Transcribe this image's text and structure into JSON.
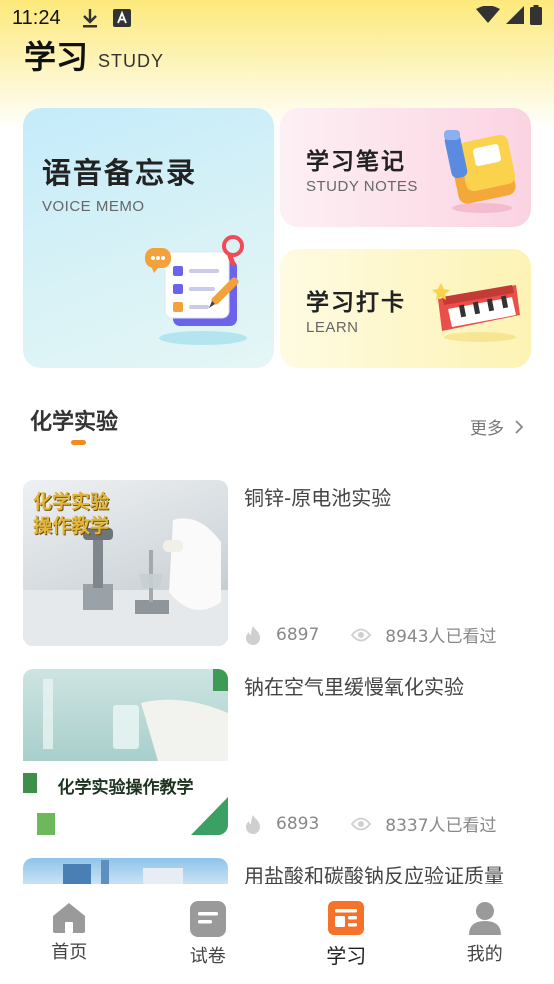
{
  "status_bar": {
    "time": "11:24"
  },
  "header": {
    "title": "学习",
    "subtitle": "STUDY"
  },
  "cards": {
    "voice": {
      "title": "语音备忘录",
      "subtitle": "VOICE MEMO"
    },
    "notes": {
      "title": "学习笔记",
      "subtitle": "STUDY NOTES"
    },
    "learn": {
      "title": "学习打卡",
      "subtitle": "LEARN"
    }
  },
  "section": {
    "title": "化学实验",
    "more_label": "更多",
    "accent_color": "#f58a1f"
  },
  "videos": [
    {
      "title": "铜锌-原电池实验",
      "heat": "6897",
      "views": "8943人已看过",
      "thumb_text_1": "化学实验",
      "thumb_text_2": "操作教学"
    },
    {
      "title": "钠在空气里缓慢氧化实验",
      "heat": "6893",
      "views": "8337人已看过",
      "thumb_text": "化学实验操作教学"
    },
    {
      "title": "用盐酸和碳酸钠反应验证质量"
    }
  ],
  "nav": {
    "items": [
      {
        "label": "首页",
        "icon": "home-icon"
      },
      {
        "label": "试卷",
        "icon": "paper-icon"
      },
      {
        "label": "学习",
        "icon": "study-icon",
        "active": true
      },
      {
        "label": "我的",
        "icon": "profile-icon"
      }
    ],
    "active_color": "#f5722b",
    "inactive_color": "#9a9a9a"
  }
}
